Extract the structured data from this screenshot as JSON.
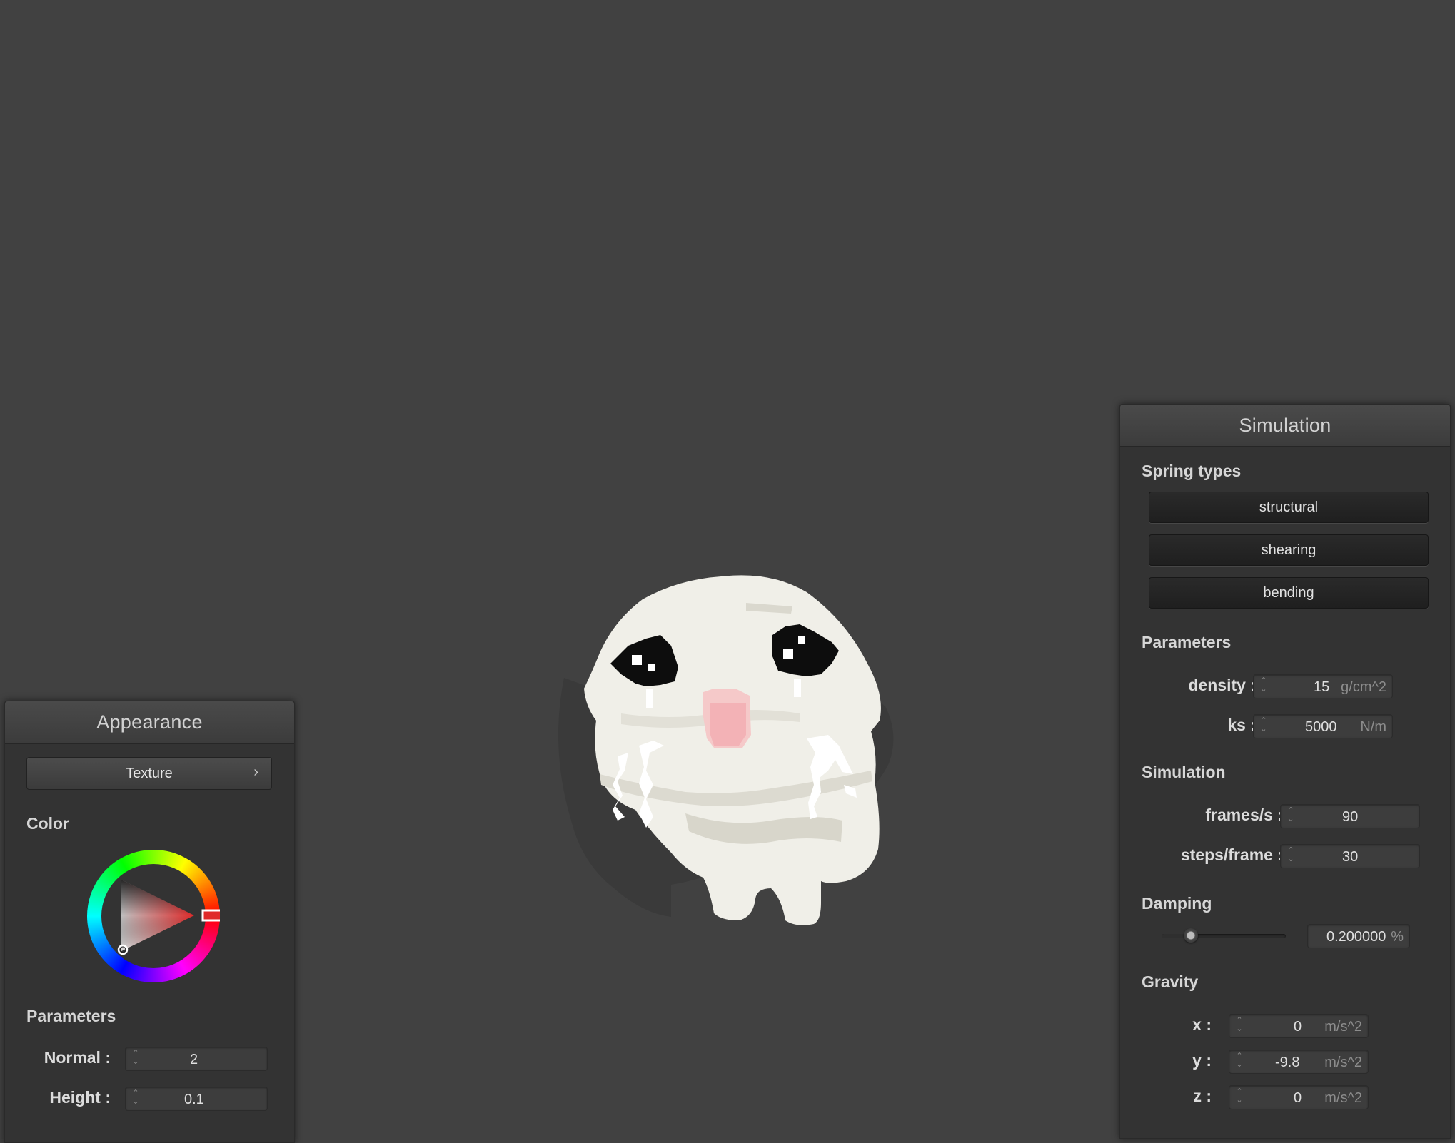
{
  "appearance": {
    "title": "Appearance",
    "texture_button": "Texture",
    "texture_arrow": "›",
    "color_label": "Color",
    "color_value": "#e02a2a",
    "parameters_label": "Parameters",
    "normal_label": "Normal :",
    "normal_value": "2",
    "height_label": "Height :",
    "height_value": "0.1"
  },
  "simulation": {
    "title": "Simulation",
    "spring_types_label": "Spring types",
    "spring_buttons": [
      "structural",
      "shearing",
      "bending"
    ],
    "parameters_label": "Parameters",
    "density_label": "density :",
    "density_value": "15",
    "density_unit": "g/cm^2",
    "ks_label": "ks :",
    "ks_value": "5000",
    "ks_unit": "N/m",
    "simulation_label": "Simulation",
    "fps_label": "frames/s :",
    "fps_value": "90",
    "steps_label": "steps/frame :",
    "steps_value": "30",
    "damping_label": "Damping",
    "damping_value": "0.200000",
    "damping_unit": "%",
    "damping_fraction": 0.2,
    "gravity_label": "Gravity",
    "gx_label": "x :",
    "gx_value": "0",
    "gy_label": "y :",
    "gy_value": "-9.8",
    "gz_label": "z :",
    "gz_value": "0",
    "gravity_unit": "m/s^2"
  },
  "icons": {
    "spinner": "spinner-arrows-icon",
    "chevron": "chevron-right-icon",
    "color_wheel": "color-wheel-icon"
  }
}
